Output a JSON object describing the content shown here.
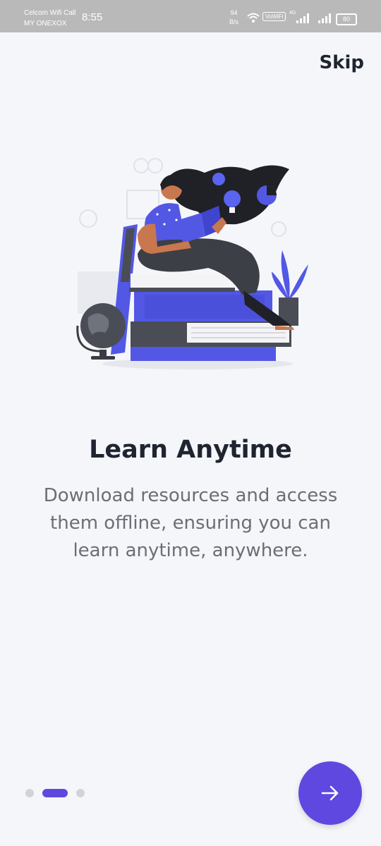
{
  "status_bar": {
    "carrier_line1": "Celcom Wifi Call",
    "carrier_line2": "MY ONEXOX",
    "time": "8:55",
    "net_speed_value": "94",
    "net_speed_unit": "B/s",
    "vowifi_label": "VoWiFi",
    "lte_label": "4G",
    "battery_level": "80"
  },
  "onboarding": {
    "skip_label": "Skip",
    "title": "Learn Anytime",
    "description": "Download resources and access them offline, ensuring you can learn anytime, anywhere.",
    "page_count": 3,
    "active_page": 1,
    "next_icon": "arrow-right-icon",
    "illustration": "woman-reading-on-books-illustration"
  },
  "colors": {
    "accent": "#5f48e0",
    "title": "#1f2530",
    "body_text": "#6b6e75",
    "background": "#f5f6fa",
    "dot_inactive": "#d2d3d7"
  }
}
